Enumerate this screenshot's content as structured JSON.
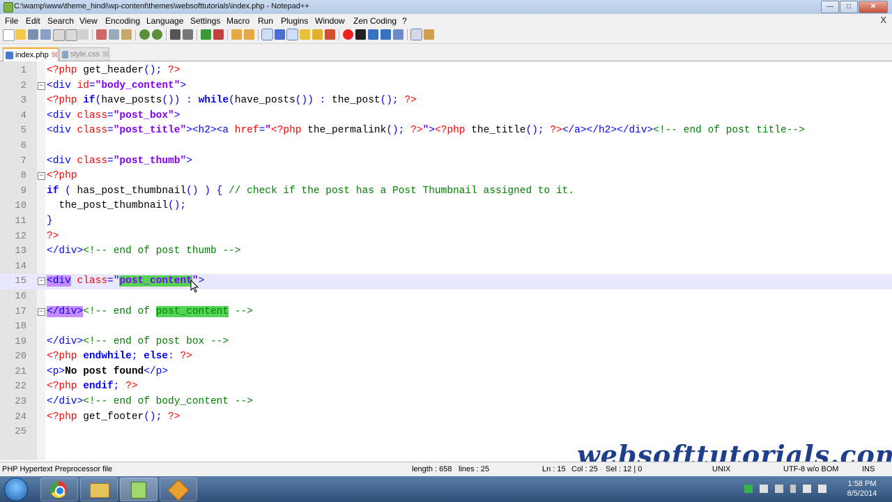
{
  "window": {
    "title": "C:\\wamp\\www\\theme_hindi\\wp-content\\themes\\websofttutorials\\index.php - Notepad++"
  },
  "menu": [
    "File",
    "Edit",
    "Search",
    "View",
    "Encoding",
    "Language",
    "Settings",
    "Macro",
    "Run",
    "Plugins",
    "Window",
    "Zen Coding",
    "?"
  ],
  "menu_close": "X",
  "tabs": [
    {
      "label": "index.php",
      "active": true
    },
    {
      "label": "style.css",
      "active": false
    }
  ],
  "lines": [
    [
      [
        "<?php ",
        "php"
      ],
      [
        "get_header",
        "fn"
      ],
      [
        "(); ",
        "op"
      ],
      [
        "?>",
        "php"
      ]
    ],
    [
      [
        "<div ",
        "tag"
      ],
      [
        "id",
        "attr"
      ],
      [
        "=",
        "op"
      ],
      [
        "\"body_content\"",
        "str"
      ],
      [
        ">",
        "tag"
      ]
    ],
    [
      [
        "<?php ",
        "php"
      ],
      [
        "if",
        "kw"
      ],
      [
        "(",
        "op"
      ],
      [
        "have_posts",
        "fn"
      ],
      [
        "()) : ",
        "op"
      ],
      [
        "while",
        "kw"
      ],
      [
        "(",
        "op"
      ],
      [
        "have_posts",
        "fn"
      ],
      [
        "()) : ",
        "op"
      ],
      [
        "the_post",
        "fn"
      ],
      [
        "(); ",
        "op"
      ],
      [
        "?>",
        "php"
      ]
    ],
    [
      [
        "<div ",
        "tag"
      ],
      [
        "class",
        "attr"
      ],
      [
        "=",
        "op"
      ],
      [
        "\"post_box\"",
        "str"
      ],
      [
        ">",
        "tag"
      ]
    ],
    [
      [
        "<div ",
        "tag"
      ],
      [
        "class",
        "attr"
      ],
      [
        "=",
        "op"
      ],
      [
        "\"post_title\"",
        "str"
      ],
      [
        "><h2><a ",
        "tag"
      ],
      [
        "href",
        "attr"
      ],
      [
        "=",
        "op"
      ],
      [
        "\"",
        "str"
      ],
      [
        "<?php ",
        "php"
      ],
      [
        "the_permalink",
        "fn"
      ],
      [
        "(); ",
        "op"
      ],
      [
        "?>",
        "php"
      ],
      [
        "\"",
        "str"
      ],
      [
        ">",
        "tag"
      ],
      [
        "<?php ",
        "php"
      ],
      [
        "the_title",
        "fn"
      ],
      [
        "(); ",
        "op"
      ],
      [
        "?>",
        "php"
      ],
      [
        "</a></h2></div>",
        "tag"
      ],
      [
        "<!-- end of post title-->",
        "com"
      ]
    ],
    [],
    [
      [
        "<div ",
        "tag"
      ],
      [
        "class",
        "attr"
      ],
      [
        "=",
        "op"
      ],
      [
        "\"post_thumb\"",
        "str"
      ],
      [
        ">",
        "tag"
      ]
    ],
    [
      [
        "<?php",
        "php"
      ]
    ],
    [
      [
        "if",
        "kw"
      ],
      [
        " ( ",
        "op"
      ],
      [
        "has_post_thumbnail",
        "fn"
      ],
      [
        "() ) { ",
        "op"
      ],
      [
        "// check if the post has a Post Thumbnail assigned to it.",
        "com"
      ]
    ],
    [
      [
        "  the_post_thumbnail",
        "fn"
      ],
      [
        "();",
        "op"
      ]
    ],
    [
      [
        "}",
        "op"
      ]
    ],
    [
      [
        "?>",
        "php"
      ]
    ],
    [
      [
        "</div>",
        "tag"
      ],
      [
        "<!-- end of post thumb -->",
        "com"
      ]
    ],
    [],
    [
      [
        "<div",
        "tag",
        "hl-tag"
      ],
      [
        " ",
        "tag"
      ],
      [
        "class",
        "attr"
      ],
      [
        "=\"",
        "op"
      ],
      [
        "post_content",
        "str",
        "hl-word"
      ],
      [
        "\"",
        "str"
      ],
      [
        ">",
        "tag"
      ]
    ],
    [],
    [
      [
        "</div>",
        "tag",
        "hl-tag"
      ],
      [
        "<!-- end of ",
        "com"
      ],
      [
        "post_content",
        "com",
        "hl-word"
      ],
      [
        " -->",
        "com"
      ]
    ],
    [],
    [
      [
        "</div>",
        "tag"
      ],
      [
        "<!-- end of post box -->",
        "com"
      ]
    ],
    [
      [
        "<?php ",
        "php"
      ],
      [
        "endwhile",
        "kw"
      ],
      [
        "; ",
        "op"
      ],
      [
        "else",
        "kw"
      ],
      [
        ": ",
        "op"
      ],
      [
        "?>",
        "php"
      ]
    ],
    [
      [
        "<p>",
        "tag"
      ],
      [
        "No post found",
        "bold"
      ],
      [
        "</p>",
        "tag"
      ]
    ],
    [
      [
        "<?php ",
        "php"
      ],
      [
        "endif",
        "kw"
      ],
      [
        "; ",
        "op"
      ],
      [
        "?>",
        "php"
      ]
    ],
    [
      [
        "</div>",
        "tag"
      ],
      [
        "<!-- end of body_content -->",
        "com"
      ]
    ],
    [
      [
        "<?php ",
        "php"
      ],
      [
        "get_footer",
        "fn"
      ],
      [
        "(); ",
        "op"
      ],
      [
        "?>",
        "php"
      ]
    ],
    []
  ],
  "current_line": 15,
  "fold_lines": [
    2,
    8,
    15,
    17
  ],
  "status": {
    "filetype": "PHP Hypertext Preprocessor file",
    "length": "length : 658",
    "lines": "lines : 25",
    "ln": "Ln : 15",
    "col": "Col : 25",
    "sel": "Sel : 12 | 0",
    "eol": "UNIX",
    "encoding": "UTF-8 w/o BOM",
    "mode": "INS"
  },
  "watermark": "websofttutorials.com",
  "clock": {
    "time": "1:58 PM",
    "date": "8/5/2014"
  },
  "colors": {
    "php": "#ff0000",
    "tag": "#0000ff",
    "string": "#8000ff",
    "comment": "#008000",
    "current_line": "#e8e8ff",
    "highlight_tag": "#c68cff",
    "highlight_word": "#55d355"
  }
}
